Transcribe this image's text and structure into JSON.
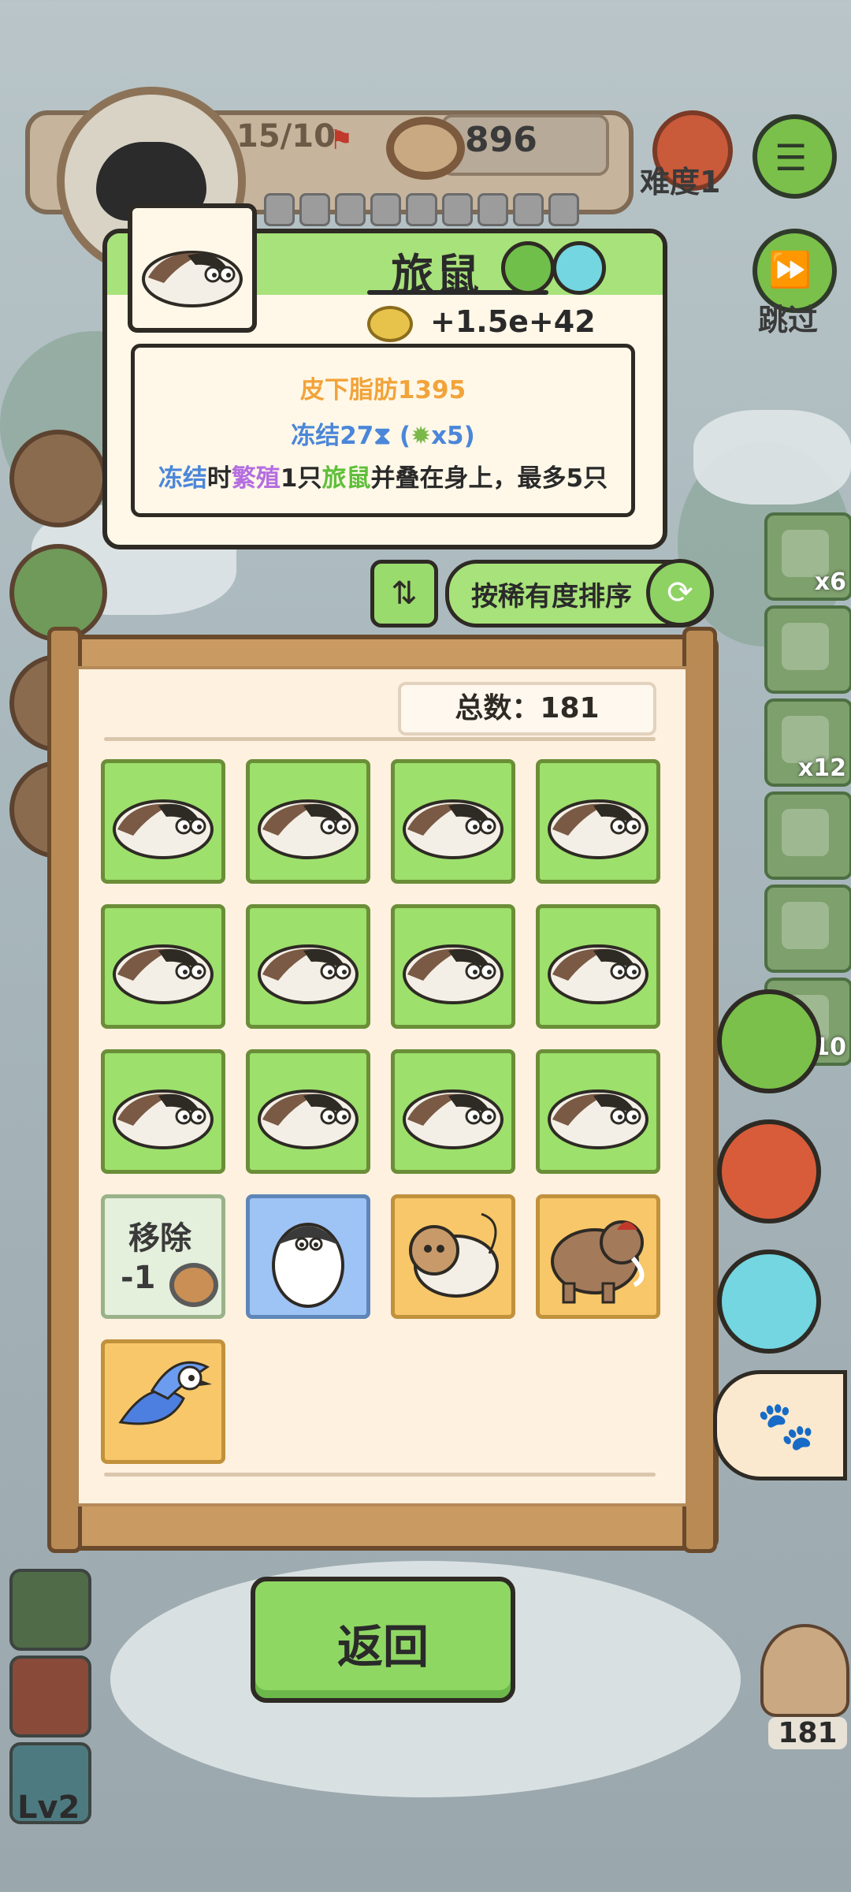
{
  "hud": {
    "population": "15/10",
    "food": "896",
    "difficulty": "难度1",
    "skip": "跳过"
  },
  "detail": {
    "title": "旅鼠",
    "power": "+1.5e+42",
    "line1": "皮下脂肪1395",
    "line2": "冻结27⧗ (",
    "line2_count": "x5)",
    "line3_a": "冻结",
    "line3_b": "时",
    "line3_c": "繁殖",
    "line3_d": "1只",
    "line3_e": "旅鼠",
    "line3_f": "并叠在身上，最多5只",
    "colors": {
      "orange": "#f2a33a",
      "blue": "#4b86d9",
      "purple": "#b46ee0",
      "green": "#5fbf3a"
    }
  },
  "sort": {
    "label": "按稀有度排序"
  },
  "collection": {
    "total_label": "总数：",
    "total_value": "181",
    "remove_label": "移除",
    "remove_cost": "-1"
  },
  "cells": [
    {
      "type": "lemming"
    },
    {
      "type": "lemming"
    },
    {
      "type": "lemming"
    },
    {
      "type": "lemming"
    },
    {
      "type": "lemming"
    },
    {
      "type": "lemming"
    },
    {
      "type": "lemming"
    },
    {
      "type": "lemming"
    },
    {
      "type": "lemming"
    },
    {
      "type": "lemming"
    },
    {
      "type": "lemming"
    },
    {
      "type": "lemming"
    },
    {
      "type": "remove"
    },
    {
      "type": "penguin"
    },
    {
      "type": "hamster"
    },
    {
      "type": "mammoth"
    },
    {
      "type": "bird"
    }
  ],
  "back": {
    "label": "返回"
  },
  "side_items": [
    {
      "icon": "fireplace-icon",
      "count": "x6"
    },
    {
      "icon": "snowglobe-icon",
      "count": ""
    },
    {
      "icon": "coffee-icon",
      "count": "x12"
    },
    {
      "icon": "card-icon",
      "count": ""
    },
    {
      "icon": "ticket-icon",
      "count": ""
    },
    {
      "icon": "item-icon",
      "count": "10"
    }
  ],
  "bottom_left": {
    "level": "Lv2"
  },
  "bottom_right": {
    "count": "181"
  }
}
